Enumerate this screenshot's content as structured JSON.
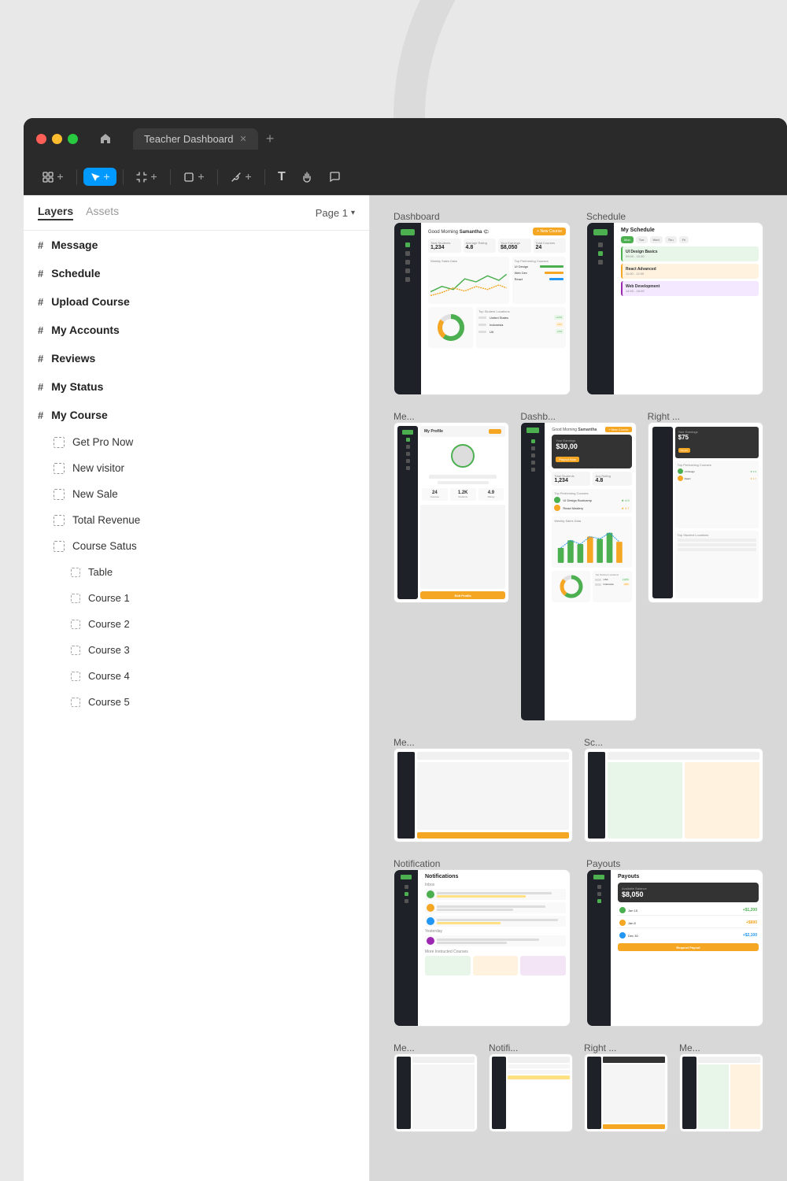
{
  "window": {
    "title": "Teacher Dashboard",
    "traffic_lights": [
      "red",
      "yellow",
      "green"
    ]
  },
  "toolbar": {
    "tools": [
      {
        "id": "move",
        "label": "Move",
        "icon": "⊞",
        "active": false
      },
      {
        "id": "select",
        "label": "Select",
        "icon": "▶",
        "active": true
      },
      {
        "id": "frame",
        "label": "Frame",
        "icon": "#",
        "active": false
      },
      {
        "id": "rect",
        "label": "Rectangle",
        "icon": "□",
        "active": false
      },
      {
        "id": "pen",
        "label": "Pen",
        "icon": "✒",
        "active": false
      },
      {
        "id": "text",
        "label": "Text",
        "icon": "T",
        "active": false
      },
      {
        "id": "hand",
        "label": "Hand",
        "icon": "✋",
        "active": false
      },
      {
        "id": "comment",
        "label": "Comment",
        "icon": "◯",
        "active": false
      }
    ]
  },
  "sidebar": {
    "tabs": [
      {
        "id": "layers",
        "label": "Layers",
        "active": true
      },
      {
        "id": "assets",
        "label": "Assets",
        "active": false
      }
    ],
    "page_label": "Page 1",
    "layers": [
      {
        "id": "message",
        "label": "Message",
        "type": "frame",
        "depth": 0
      },
      {
        "id": "schedule",
        "label": "Schedule",
        "type": "frame",
        "depth": 0
      },
      {
        "id": "upload-course",
        "label": "Upload Course",
        "type": "frame",
        "depth": 0
      },
      {
        "id": "my-accounts",
        "label": "My Accounts",
        "type": "frame",
        "depth": 0
      },
      {
        "id": "reviews",
        "label": "Reviews",
        "type": "frame",
        "depth": 0
      },
      {
        "id": "my-status",
        "label": "My Status",
        "type": "frame",
        "depth": 0
      },
      {
        "id": "my-course",
        "label": "My Course",
        "type": "frame",
        "depth": 0
      }
    ],
    "my_course_children": [
      {
        "id": "get-pro-now",
        "label": "Get Pro Now"
      },
      {
        "id": "new-visitor",
        "label": "New visitor"
      },
      {
        "id": "new-sale",
        "label": "New Sale"
      },
      {
        "id": "total-revenue",
        "label": "Total Revenue"
      },
      {
        "id": "course-status",
        "label": "Course Satus"
      }
    ],
    "course_status_children": [
      {
        "id": "table",
        "label": "Table"
      },
      {
        "id": "course-1",
        "label": "Course 1"
      },
      {
        "id": "course-2",
        "label": "Course 2"
      },
      {
        "id": "course-3",
        "label": "Course 3"
      },
      {
        "id": "course-4",
        "label": "Course 4"
      },
      {
        "id": "course-5",
        "label": "Course 5"
      }
    ]
  },
  "canvas": {
    "frames": [
      {
        "id": "dashboard",
        "label": "Dashboard"
      },
      {
        "id": "schedule",
        "label": "Schedule"
      },
      {
        "id": "me",
        "label": "Me..."
      },
      {
        "id": "dashb",
        "label": "Dashb..."
      },
      {
        "id": "right",
        "label": "Right ..."
      },
      {
        "id": "me2",
        "label": "Me..."
      },
      {
        "id": "sc",
        "label": "Sc..."
      },
      {
        "id": "notification",
        "label": "Notification"
      },
      {
        "id": "payouts",
        "label": "Payouts"
      },
      {
        "id": "me3",
        "label": "Me..."
      },
      {
        "id": "notifi",
        "label": "Notifi..."
      },
      {
        "id": "right2",
        "label": "Right ..."
      },
      {
        "id": "me4",
        "label": "Me..."
      }
    ]
  }
}
